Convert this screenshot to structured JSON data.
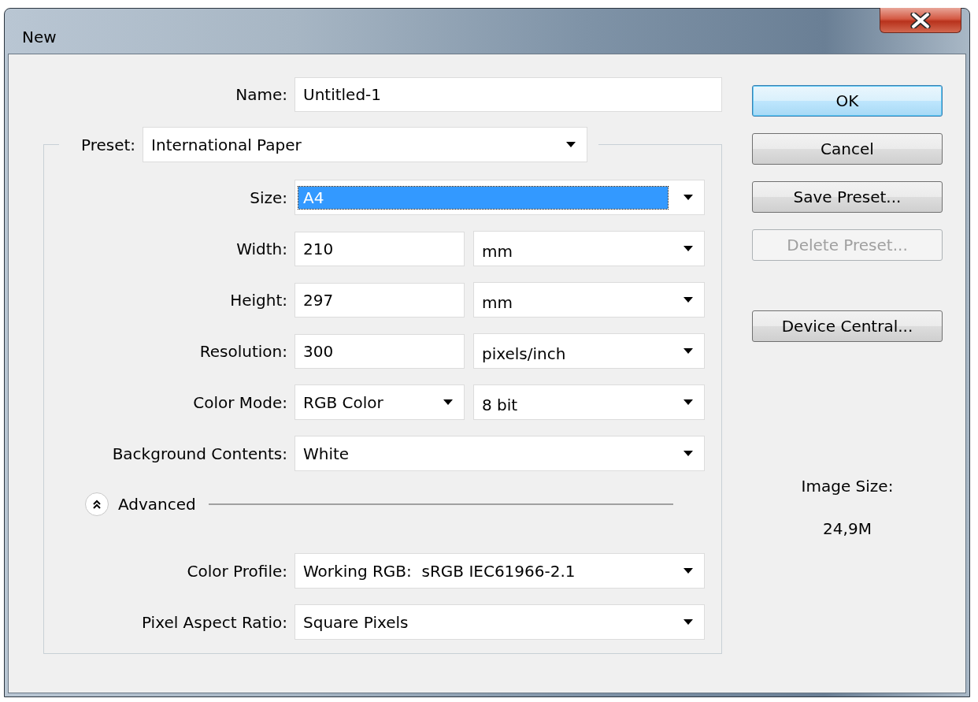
{
  "window": {
    "title": "New"
  },
  "name_field": {
    "label": "Name:",
    "value": "Untitled-1"
  },
  "preset": {
    "label": "Preset:",
    "value": "International Paper"
  },
  "fields": [
    {
      "kind": "select",
      "label": "Size:",
      "value": "A4",
      "focused": true
    },
    {
      "kind": "input_unit",
      "label": "Width:",
      "value": "210",
      "unit": "mm",
      "focused": false
    },
    {
      "kind": "input_unit",
      "label": "Height:",
      "value": "297",
      "unit": "mm",
      "focused": false
    },
    {
      "kind": "input_unit",
      "label": "Resolution:",
      "value": "300",
      "unit": "pixels/inch",
      "focused": false
    },
    {
      "kind": "select_pair",
      "label": "Color Mode:",
      "value": "RGB Color",
      "unit": "8 bit",
      "focused": false
    },
    {
      "kind": "select",
      "label": "Background Contents:",
      "value": "White",
      "focused": false
    }
  ],
  "advanced": {
    "label": "Advanced",
    "expanded": true
  },
  "advanced_fields": [
    {
      "kind": "select",
      "label": "Color Profile:",
      "value": "Working RGB:  sRGB IEC61966-2.1",
      "focused": false
    },
    {
      "kind": "select",
      "label": "Pixel Aspect Ratio:",
      "value": "Square Pixels",
      "focused": false
    }
  ],
  "buttons": [
    {
      "label": "OK",
      "default": true,
      "disabled": false
    },
    {
      "label": "Cancel",
      "default": false,
      "disabled": false
    },
    {
      "label": "Save Preset...",
      "default": false,
      "disabled": false
    },
    {
      "label": "Delete Preset...",
      "default": false,
      "disabled": true
    },
    {
      "label": "Device Central...",
      "default": false,
      "disabled": false
    }
  ],
  "image_size": {
    "label": "Image Size:",
    "value": "24,9M"
  }
}
